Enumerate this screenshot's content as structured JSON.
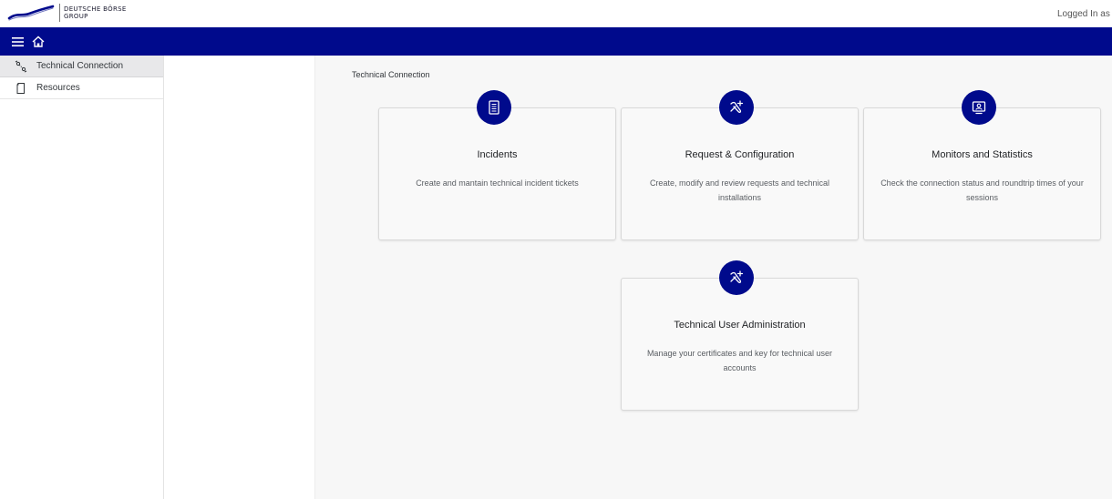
{
  "header": {
    "logo_text": "DEUTSCHE BÖRSE\nGROUP",
    "logged_in": "Logged In as"
  },
  "colors": {
    "primary": "#000a8c",
    "sidebar_active": "#e8e8ea",
    "main_bg": "#f7f7f7"
  },
  "navbar": {
    "icons": [
      "menu-icon",
      "home-icon"
    ]
  },
  "sidebar": {
    "items": [
      {
        "label": "Technical Connection",
        "icon": "connection-icon",
        "active": true
      },
      {
        "label": "Resources",
        "icon": "document-icon",
        "active": false
      }
    ]
  },
  "main": {
    "title": "Technical Connection",
    "cards": [
      {
        "title": "Incidents",
        "description": "Create and mantain technical incident tickets",
        "icon": "ticket-list-icon"
      },
      {
        "title": "Request & Configuration",
        "description": "Create, modify and review requests and technical installations",
        "icon": "tools-icon"
      },
      {
        "title": "Monitors and Statistics",
        "description": "Check the connection status and roundtrip times of your sessions",
        "icon": "monitor-icon"
      },
      {
        "title": "Technical User Administration",
        "description": "Manage your certificates and key for technical user accounts",
        "icon": "tools-icon"
      }
    ]
  }
}
